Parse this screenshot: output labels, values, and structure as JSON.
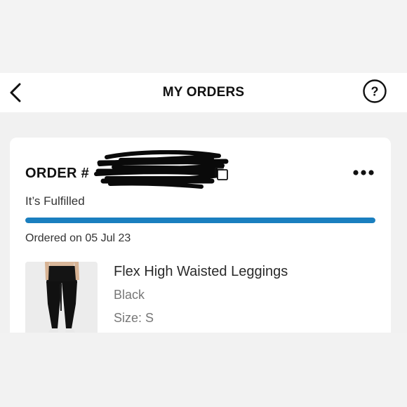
{
  "header": {
    "title": "MY ORDERS",
    "back_icon": "chevron-left-icon",
    "help_icon": "question-circle-icon"
  },
  "order": {
    "title": "ORDER #",
    "copy_icon": "copy-icon",
    "more_icon": "more-horizontal-icon",
    "status": "It’s Fulfilled",
    "progress": 1.0,
    "ordered_on": "Ordered on 05 Jul 23",
    "accent_color": "#1a7fbf"
  },
  "product": {
    "name": "Flex High Waisted Leggings",
    "color": "Black",
    "size": "Size: S"
  }
}
